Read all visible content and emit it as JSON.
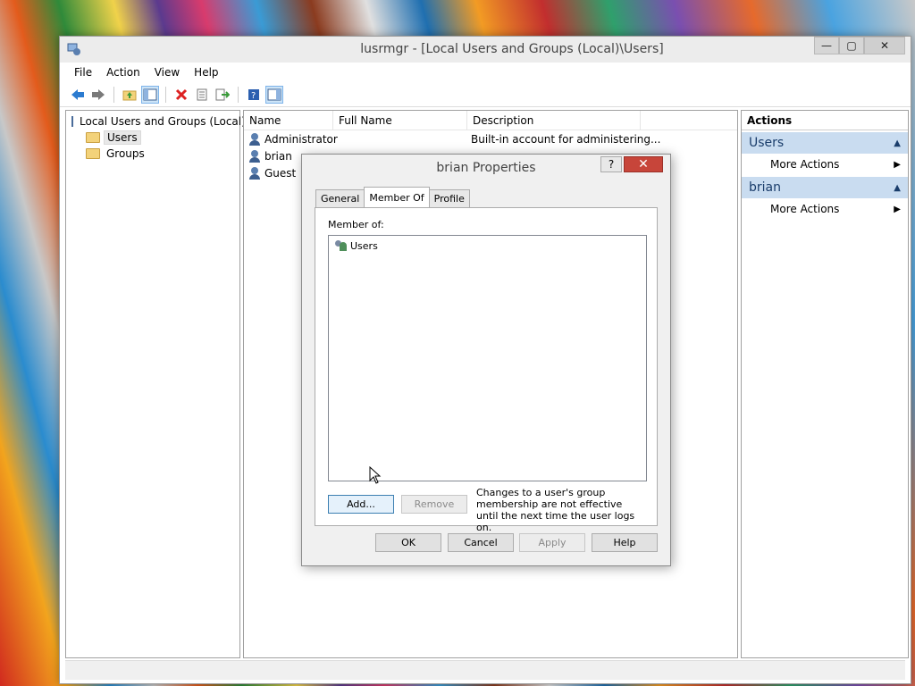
{
  "window": {
    "title": "lusrmgr - [Local Users and Groups (Local)\\Users]",
    "minimize": "—",
    "maximize": "▢",
    "close": "✕"
  },
  "menu": [
    "File",
    "Action",
    "View",
    "Help"
  ],
  "toolbar": {
    "icons": [
      "back-icon",
      "forward-icon",
      "up-folder-icon",
      "show-hide-console-tree-icon",
      "delete-icon",
      "properties-icon",
      "export-list-icon",
      "help-icon",
      "show-hide-action-pane-icon"
    ]
  },
  "tree": {
    "root": "Local Users and Groups (Local)",
    "children": [
      "Users",
      "Groups"
    ],
    "selected": "Users"
  },
  "list": {
    "columns": [
      "Name",
      "Full Name",
      "Description"
    ],
    "rows": [
      {
        "name": "Administrator",
        "full_name": "",
        "description": "Built-in account for administering..."
      },
      {
        "name": "brian",
        "full_name": "",
        "description": ""
      },
      {
        "name": "Guest",
        "full_name": "",
        "description": ""
      }
    ]
  },
  "actions": {
    "header": "Actions",
    "sections": [
      {
        "title": "Users",
        "item": "More Actions"
      },
      {
        "title": "brian",
        "item": "More Actions"
      }
    ]
  },
  "dialog": {
    "title": "brian Properties",
    "help": "?",
    "close": "✕",
    "tabs": [
      "General",
      "Member Of",
      "Profile"
    ],
    "active_tab": "Member Of",
    "member_of_label": "Member of:",
    "groups": [
      "Users"
    ],
    "add_button": "Add...",
    "remove_button": "Remove",
    "note": "Changes to a user's group membership are not effective until the next time the user logs on.",
    "ok": "OK",
    "cancel": "Cancel",
    "apply": "Apply",
    "help_button": "Help"
  }
}
